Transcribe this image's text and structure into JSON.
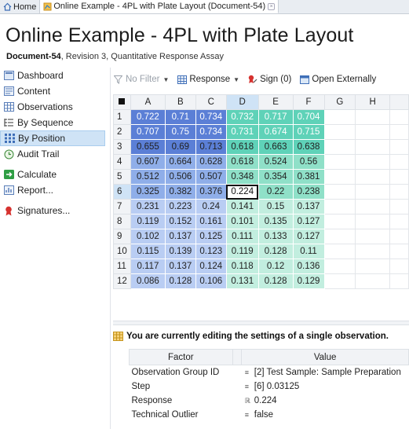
{
  "tabs": [
    {
      "label": "Home",
      "icon": "home-icon",
      "active": false
    },
    {
      "label": "Online Example - 4PL with Plate Layout (Document-54)",
      "icon": "document-icon",
      "active": true
    }
  ],
  "header": {
    "title": "Online Example - 4PL with Plate Layout",
    "doc_id": "Document-54",
    "subtitle_rest": ", Revision 3, Quantitative Response Assay"
  },
  "sidebar": {
    "items": [
      {
        "label": "Dashboard",
        "icon": "dashboard-icon"
      },
      {
        "label": "Content",
        "icon": "content-icon"
      },
      {
        "label": "Observations",
        "icon": "table-icon"
      },
      {
        "label": "By Sequence",
        "icon": "list-icon"
      },
      {
        "label": "By Position",
        "icon": "grid-icon",
        "selected": true
      },
      {
        "label": "Audit Trail",
        "icon": "history-icon"
      },
      {
        "label": "Calculate",
        "icon": "arrow-right-icon"
      },
      {
        "label": "Report...",
        "icon": "report-icon"
      },
      {
        "label": "Signatures...",
        "icon": "ribbon-icon"
      }
    ]
  },
  "toolbar": {
    "filter_label": "No Filter",
    "response_label": "Response",
    "sign_label": "Sign (0)",
    "open_label": "Open Externally"
  },
  "plate": {
    "columns": [
      "A",
      "B",
      "C",
      "D",
      "E",
      "F",
      "G",
      "H"
    ],
    "selected_column": "D",
    "selected_row": "6",
    "rows": [
      {
        "label": "1",
        "values": [
          "0.722",
          "0.71",
          "0.734",
          "0.732",
          "0.717",
          "0.704"
        ]
      },
      {
        "label": "2",
        "values": [
          "0.707",
          "0.75",
          "0.734",
          "0.731",
          "0.674",
          "0.715"
        ]
      },
      {
        "label": "3",
        "values": [
          "0.655",
          "0.69",
          "0.713",
          "0.618",
          "0.663",
          "0.638"
        ]
      },
      {
        "label": "4",
        "values": [
          "0.607",
          "0.664",
          "0.628",
          "0.618",
          "0.524",
          "0.56"
        ]
      },
      {
        "label": "5",
        "values": [
          "0.512",
          "0.506",
          "0.507",
          "0.348",
          "0.354",
          "0.381"
        ]
      },
      {
        "label": "6",
        "values": [
          "0.325",
          "0.382",
          "0.376",
          "0.224",
          "0.22",
          "0.238"
        ]
      },
      {
        "label": "7",
        "values": [
          "0.231",
          "0.223",
          "0.24",
          "0.141",
          "0.15",
          "0.137"
        ]
      },
      {
        "label": "8",
        "values": [
          "0.119",
          "0.152",
          "0.161",
          "0.101",
          "0.135",
          "0.127"
        ]
      },
      {
        "label": "9",
        "values": [
          "0.102",
          "0.137",
          "0.125",
          "0.111",
          "0.133",
          "0.127"
        ]
      },
      {
        "label": "10",
        "values": [
          "0.115",
          "0.139",
          "0.123",
          "0.119",
          "0.128",
          "0.11"
        ]
      },
      {
        "label": "11",
        "values": [
          "0.117",
          "0.137",
          "0.124",
          "0.118",
          "0.12",
          "0.136"
        ]
      },
      {
        "label": "12",
        "values": [
          "0.086",
          "0.128",
          "0.106",
          "0.131",
          "0.128",
          "0.129"
        ]
      }
    ],
    "colors": {
      "blue_dark": "#5b7fd6",
      "blue_mid": "#8faee9",
      "blue_light": "#b9cdf3",
      "teal_dark": "#5fd2b8",
      "teal_mid": "#8fe0c8",
      "teal_light": "#c2eedf"
    }
  },
  "banner": {
    "text": "You are currently editing the settings of a single observation."
  },
  "properties": {
    "factor_header": "Factor",
    "value_header": "Value",
    "rows": [
      {
        "factor": "Observation Group ID",
        "icon": "≡",
        "value": "[2] Test Sample: Sample Preparation"
      },
      {
        "factor": "Step",
        "icon": "≡",
        "value": "[6] 0.03125"
      },
      {
        "factor": "Response",
        "icon": "ℝ",
        "value": "0.224"
      },
      {
        "factor": "Technical Outlier",
        "icon": "≡",
        "value": "false"
      }
    ]
  }
}
